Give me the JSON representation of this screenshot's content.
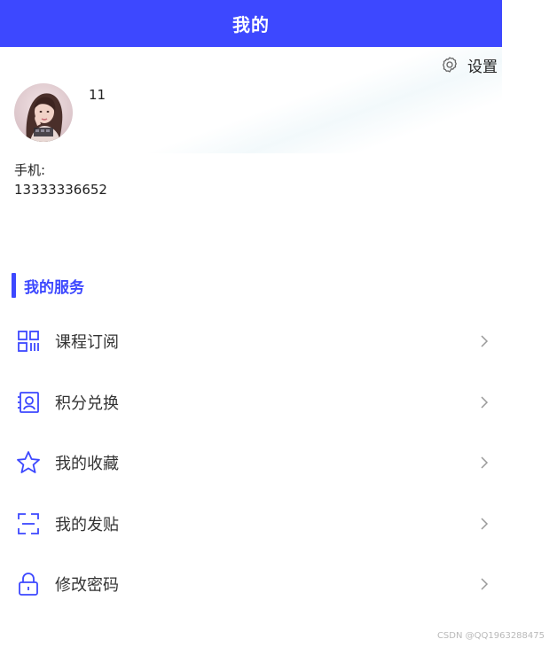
{
  "header": {
    "title": "我的"
  },
  "settings": {
    "label": "设置",
    "icon": "gear-icon"
  },
  "profile": {
    "username": "11",
    "phone_label": "手机:",
    "phone_value": "13333336652",
    "avatar": "avatar-photo"
  },
  "services": {
    "title": "我的服务",
    "items": [
      {
        "label": "课程订阅",
        "icon": "grid-icon"
      },
      {
        "label": "积分兑换",
        "icon": "profile-card-icon"
      },
      {
        "label": "我的收藏",
        "icon": "star-icon"
      },
      {
        "label": "我的发贴",
        "icon": "scan-frame-icon"
      },
      {
        "label": "修改密码",
        "icon": "lock-icon"
      }
    ]
  },
  "watermark": {
    "text": "CSDN @QQ1963288475"
  },
  "colors": {
    "accent": "#3d48ff",
    "icon_stroke": "#3d48ff",
    "arrow": "#9a9a9a"
  }
}
